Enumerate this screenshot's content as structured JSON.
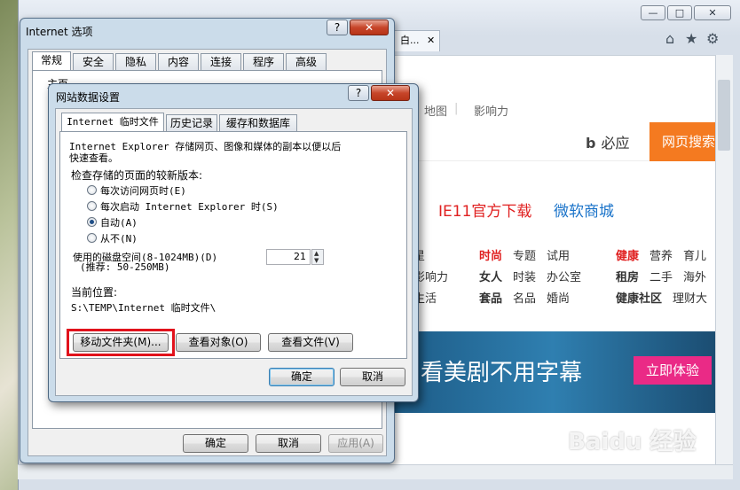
{
  "browser": {
    "tab_label": "白...",
    "nav_links": [
      "地图",
      "影响力"
    ],
    "bing_logo": "必应",
    "search_button": "网页搜索",
    "promos": [
      {
        "text": "IE11官方下载",
        "color": "#e02020"
      },
      {
        "text": "微软商城",
        "color": "#1a73c9"
      }
    ],
    "category_rows": [
      [
        "时尚",
        "专题",
        "试用",
        "健康",
        "营养",
        "育儿"
      ],
      [
        "女人",
        "时装",
        "办公室",
        "租房",
        "二手",
        "海外"
      ],
      [
        "套品",
        "名品",
        "婚尚",
        "健康社区",
        "理财大"
      ]
    ],
    "left_category_fragments": [
      "星",
      "影响力",
      "生活"
    ],
    "banner_text": "看美剧不用字幕",
    "banner_button": "立即体验",
    "watermark": "Baidu 经验",
    "watermark_url": "jingyan.baidu.com"
  },
  "inet_options": {
    "title": "Internet 选项",
    "tabs": [
      "常规",
      "安全",
      "隐私",
      "内容",
      "连接",
      "程序",
      "高级"
    ],
    "active_tab": "常规",
    "section_label": "主页",
    "buttons": {
      "ok": "确定",
      "cancel": "取消",
      "apply": "应用(A)"
    }
  },
  "data_settings": {
    "title": "网站数据设置",
    "tabs": [
      "Internet 临时文件",
      "历史记录",
      "缓存和数据库"
    ],
    "active_tab": "Internet 临时文件",
    "description_line1": "Internet Explorer 存储网页、图像和媒体的副本以便以后",
    "description_line2": "快速查看。",
    "check_label": "检查存储的页面的较新版本:",
    "radio_options": [
      {
        "label": "每次访问网页时(E)",
        "checked": false
      },
      {
        "label": "每次启动 Internet Explorer 时(S)",
        "checked": false
      },
      {
        "label": "自动(A)",
        "checked": true
      },
      {
        "label": "从不(N)",
        "checked": false
      }
    ],
    "disk_label_line1": "使用的磁盘空间(8-1024MB)(D)",
    "disk_label_line2": "(推荐: 50-250MB)",
    "disk_value": "21",
    "location_label": "当前位置:",
    "location_path": "S:\\TEMP\\Internet 临时文件\\",
    "buttons": {
      "move_folder": "移动文件夹(M)...",
      "view_objects": "查看对象(O)",
      "view_files": "查看文件(V)",
      "ok": "确定",
      "cancel": "取消"
    }
  },
  "colors": {
    "highlight": "#e1121c",
    "search_orange": "#f47a20",
    "banner_pink": "#ea2a86"
  }
}
